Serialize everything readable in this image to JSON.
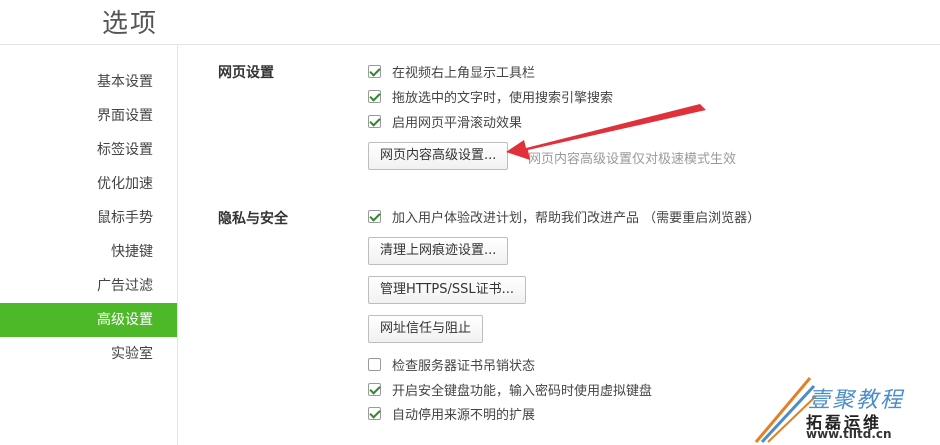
{
  "page": {
    "title": "选项"
  },
  "sidebar": {
    "items": [
      {
        "label": "基本设置"
      },
      {
        "label": "界面设置"
      },
      {
        "label": "标签设置"
      },
      {
        "label": "优化加速"
      },
      {
        "label": "鼠标手势"
      },
      {
        "label": "快捷键"
      },
      {
        "label": "广告过滤"
      },
      {
        "label": "高级设置",
        "active": true
      },
      {
        "label": "实验室"
      }
    ]
  },
  "webpage": {
    "title": "网页设置",
    "options": [
      {
        "label": "在视频右上角显示工具栏",
        "checked": true
      },
      {
        "label": "拖放选中的文字时，使用搜索引擎搜索",
        "checked": true
      },
      {
        "label": "启用网页平滑滚动效果",
        "checked": true
      }
    ],
    "advanced_button": "网页内容高级设置...",
    "hint": "网页内容高级设置仅对极速模式生效"
  },
  "privacy": {
    "title": "隐私与安全",
    "join_option": {
      "label": "加入用户体验改进计划，帮助我们改进产品 （需要重启浏览器）",
      "checked": true
    },
    "clear_button": "清理上网痕迹设置...",
    "cert_button": "管理HTTPS/SSL证书...",
    "trust_button": "网址信任与阻止",
    "options": [
      {
        "label": "检查服务器证书吊销状态",
        "checked": false
      },
      {
        "label": "开启安全键盘功能，输入密码时使用虚拟键盘",
        "checked": true
      },
      {
        "label": "自动停用来源不明的扩展",
        "checked": true
      }
    ]
  },
  "watermark": {
    "line1": "壹聚教程",
    "line2": "拓磊运维",
    "line3": "www.tlltd.cn"
  },
  "colors": {
    "accent": "#4db929",
    "arrow": "#e0303a"
  }
}
